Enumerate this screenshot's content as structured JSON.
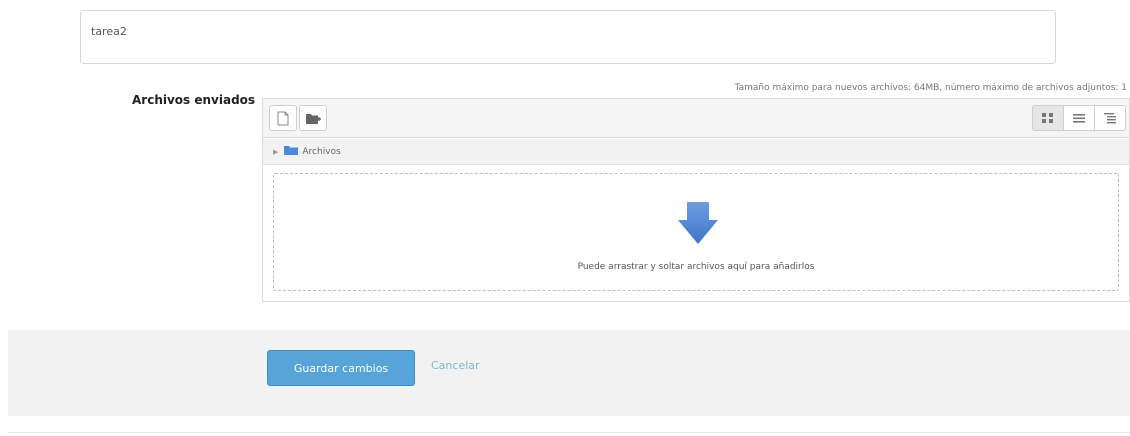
{
  "text_field": {
    "value": "tarea2"
  },
  "submission": {
    "label": "Archivos enviados",
    "limits": "Tamaño máximo para nuevos archivos: 64MB, número máximo de archivos adjuntos: 1"
  },
  "filemanager": {
    "path_label": "Archivos",
    "dropzone_text": "Puede arrastrar y soltar archivos aquí para añadirlos",
    "icons": {
      "add": "add-file-icon",
      "folder": "create-folder-icon",
      "view_icons": "view-icons-icon",
      "view_details": "view-details-icon",
      "view_tree": "view-tree-icon",
      "drop": "down-arrow-icon"
    }
  },
  "actions": {
    "save_label": "Guardar cambios",
    "cancel_label": "Cancelar"
  },
  "colors": {
    "primary": "#56a4d8",
    "link": "#7fb6d6",
    "dropzone_border": "#bcbcbc"
  }
}
